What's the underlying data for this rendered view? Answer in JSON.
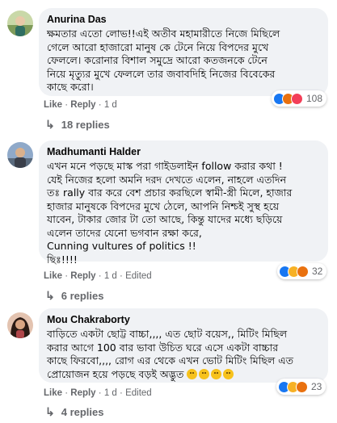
{
  "comments": [
    {
      "author": "Anurina Das",
      "text": "ক্ষমতার এতো লোভ!!এই অতীব মহামারীতে নিজে মিছিলে\nগেলে আরো হাজারো মানুষ কে টেনে নিয়ে বিপদের মুখে\nফেললে। করোনার বিশাল সমুদ্রে আরো কতজনকে টেনে\nনিয়ে মৃত্যুর মুখে ফেললে তার জবাবদিহি নিজের বিবেকের\nকাছে করো।",
      "like": "Like",
      "reply": "Reply",
      "time": "1 d",
      "edited": "",
      "reactions": [
        "like",
        "angry",
        "love"
      ],
      "reaction_count": "108",
      "replies": "18 replies"
    },
    {
      "author": "Madhumanti Halder",
      "text": "এখন মনে পড়ছে মাস্ক পরা গাইডলাইন follow করার কথা !\nযেই নিজের হলো অমনি দরদ দেখতে এলেন, নাহলে এতদিন\nতঃ rally বার করে বেশ প্রচার করছিলে স্বামী-স্ত্রী মিলে, হাজার\nহাজার মানুষকে বিপদের মুখে ঠেলে, আপনি নিশ্চই সুস্থ হয়ে\nযাবেন, টাকার জোর টা তো আছে, কিন্তু যাদের মধ্যে ছড়িয়ে\nএলেন তাদের যেনো ভগবান রক্ষা করে,\nCunning vultures of politics !!\nছিঃ!!!!",
      "like": "Like",
      "reply": "Reply",
      "time": "1 d",
      "edited": "Edited",
      "reactions": [
        "like",
        "haha",
        "angry"
      ],
      "reaction_count": "32",
      "replies": "6 replies"
    },
    {
      "author": "Mou Chakraborty",
      "text": "বাড়িতে একটা ছোট্ট বাচ্চা,,,, এত ছোট বয়েস,, মিটিং মিছিল\nকরার আগে 100 বার ভাবা উচিত ঘরে এসে একটা বাচ্চার\nকাছে ফিরবো,,,, রোগ এর থেকে এখন ভোট মিটিং মিছিল এত\nপ্রোয়োজন হয়ে পড়ছে বড়ই অদ্ভুত",
      "like": "Like",
      "reply": "Reply",
      "time": "1 d",
      "edited": "Edited",
      "reactions": [
        "like",
        "haha",
        "angry"
      ],
      "reaction_count": "23",
      "replies": "4 replies"
    }
  ],
  "meta_separator": "·",
  "colors": {
    "bubble": "#f0f2f5",
    "meta_text": "#65676b",
    "like_blue": "#1877f2",
    "love_red": "#f33e58",
    "angry_orange": "#e9710f",
    "haha_yellow": "#f7b125"
  }
}
